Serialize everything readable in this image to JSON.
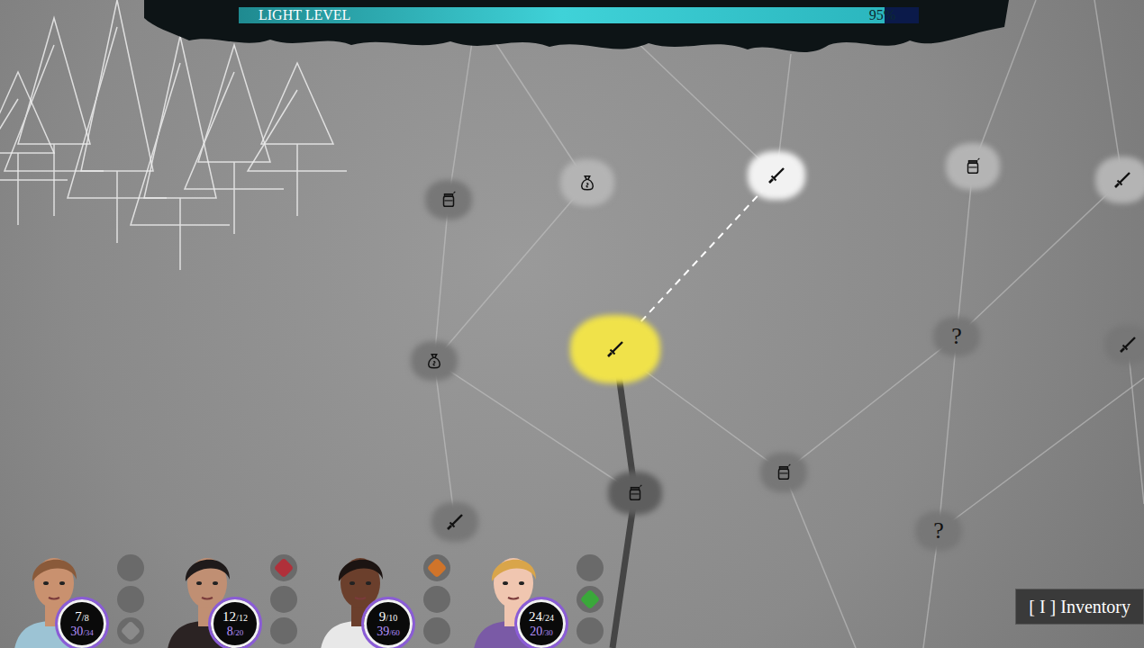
{
  "light": {
    "label": "LIGHT LEVEL",
    "reading": "95%",
    "level": 0.95
  },
  "map": {
    "nodes": [
      {
        "kind": "potion",
        "state": "hidden"
      },
      {
        "kind": "loot",
        "state": "revealed"
      },
      {
        "kind": "fight",
        "state": "selectable"
      },
      {
        "kind": "potion",
        "state": "revealed"
      },
      {
        "kind": "fight",
        "state": "revealed"
      },
      {
        "kind": "loot",
        "state": "hidden"
      },
      {
        "kind": "fight",
        "state": "current"
      },
      {
        "kind": "unknown",
        "state": "hidden",
        "label": "?"
      },
      {
        "kind": "potion",
        "state": "visited"
      },
      {
        "kind": "potion",
        "state": "hidden"
      },
      {
        "kind": "fight",
        "state": "hidden"
      },
      {
        "kind": "unknown",
        "state": "hidden",
        "label": "?"
      },
      {
        "kind": "fight",
        "state": "hidden"
      }
    ],
    "edges": [
      {
        "from": 5,
        "to": 0,
        "kind": "plain"
      },
      {
        "from": 5,
        "to": 1,
        "kind": "plain"
      },
      {
        "from": 0,
        "to": 13,
        "kind": "plain"
      },
      {
        "from": 1,
        "to": 14,
        "kind": "plain"
      },
      {
        "from": 15,
        "to": 2,
        "kind": "plain"
      },
      {
        "from": 2,
        "to": 16,
        "kind": "plain"
      },
      {
        "from": 3,
        "to": 17,
        "kind": "plain"
      },
      {
        "from": 3,
        "to": 7,
        "kind": "plain"
      },
      {
        "from": 7,
        "to": 4,
        "kind": "plain"
      },
      {
        "from": 4,
        "to": 18,
        "kind": "plain"
      },
      {
        "from": 7,
        "to": 11,
        "kind": "plain"
      },
      {
        "from": 7,
        "to": 9,
        "kind": "plain"
      },
      {
        "from": 6,
        "to": 9,
        "kind": "plain"
      },
      {
        "from": 5,
        "to": 8,
        "kind": "plain"
      },
      {
        "from": 5,
        "to": 10,
        "kind": "plain"
      },
      {
        "from": 9,
        "to": 21,
        "kind": "plain"
      },
      {
        "from": 11,
        "to": 22,
        "kind": "plain"
      },
      {
        "from": 11,
        "to": 20,
        "kind": "plain"
      },
      {
        "from": 12,
        "to": 23,
        "kind": "plain"
      },
      {
        "from": 8,
        "to": 19,
        "kind": "visited"
      },
      {
        "from": 6,
        "to": 8,
        "kind": "visited"
      },
      {
        "from": 6,
        "to": 2,
        "kind": "planned"
      }
    ]
  },
  "party": [
    {
      "hp": "7",
      "hp_max": "/8",
      "light": "30",
      "light_max": "/34",
      "color": "#c9916f",
      "hair_color": "#8a5a3a",
      "clothing_color": "#9cc3d4",
      "slots": [
        {
          "filled": false
        },
        {
          "filled": false
        },
        {
          "filled": true,
          "color": "#8a8a8a"
        }
      ]
    },
    {
      "hp": "12",
      "hp_max": "/12",
      "light": "8",
      "light_max": "/20",
      "color": "#c08f73",
      "hair_color": "#1f1a1a",
      "clothing_color": "#2b2323",
      "slots": [
        {
          "filled": true,
          "color": "#b0303a"
        },
        {
          "filled": false
        },
        {
          "filled": false
        }
      ]
    },
    {
      "hp": "9",
      "hp_max": "/10",
      "light": "39",
      "light_max": "/60",
      "color": "#6b3f2c",
      "hair_color": "#1c1412",
      "clothing_color": "#e8e8e8",
      "slots": [
        {
          "filled": true,
          "color": "#d0742a"
        },
        {
          "filled": false
        },
        {
          "filled": false
        }
      ]
    },
    {
      "hp": "24",
      "hp_max": "/24",
      "light": "20",
      "light_max": "/30",
      "color": "#f0c6b0",
      "hair_color": "#d9a54a",
      "clothing_color": "#7a5aa6",
      "slots": [
        {
          "filled": false
        },
        {
          "filled": true,
          "color": "#3aa83a"
        },
        {
          "filled": false
        }
      ]
    }
  ],
  "inventory_button": {
    "label": "[ I ] Inventory"
  }
}
